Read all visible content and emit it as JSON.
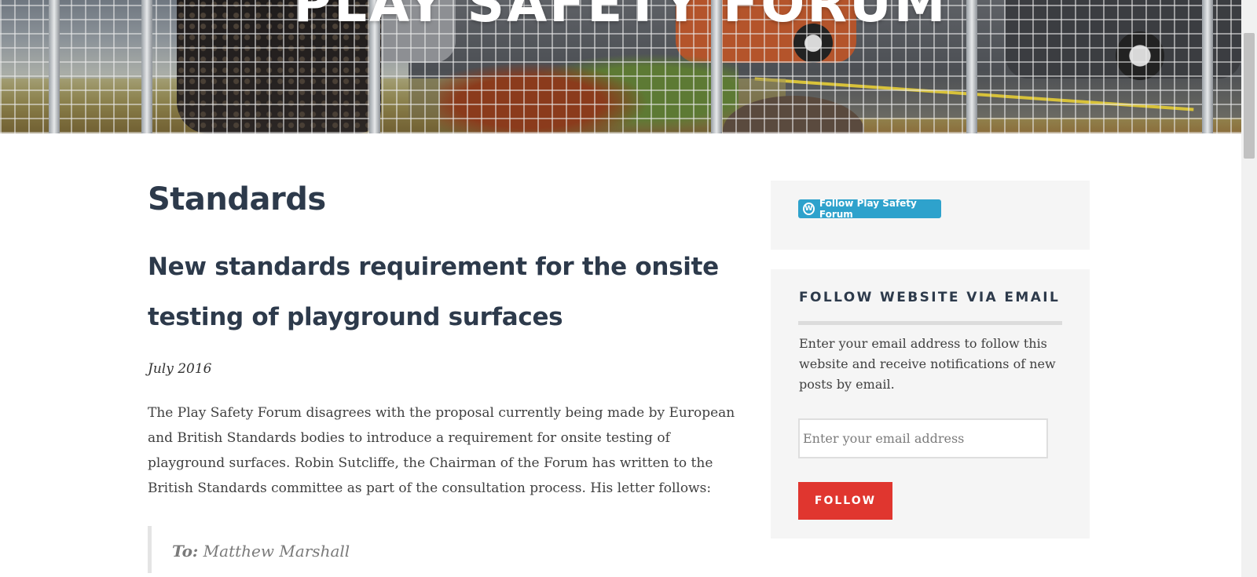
{
  "header": {
    "site_title": "PLAY SAFETY FORUM"
  },
  "main": {
    "page_title": "Standards",
    "post_title": "New standards requirement for the onsite testing of playground surfaces",
    "post_date": "July 2016",
    "post_body": "The Play Safety Forum disagrees with the proposal currently being made by European and British Standards bodies to introduce a requirement for onsite testing of playground surfaces. Robin Sutcliffe, the Chairman of the Forum has written to the British Standards committee as part of the consultation process. His letter follows:",
    "quote": {
      "label": "To:",
      "recipient": "Matthew Marshall"
    }
  },
  "sidebar": {
    "follow_widget": {
      "button_label": "Follow Play Safety Forum",
      "icon": "wordpress-icon",
      "accent": "#2ea2cc"
    },
    "email_widget": {
      "title": "FOLLOW WEBSITE VIA EMAIL",
      "description": "Enter your email address to follow this website and receive notifications of new posts by email.",
      "email_placeholder": "Enter your email address",
      "email_value": "",
      "follow_label": "FOLLOW",
      "accent": "#e0362f"
    }
  }
}
